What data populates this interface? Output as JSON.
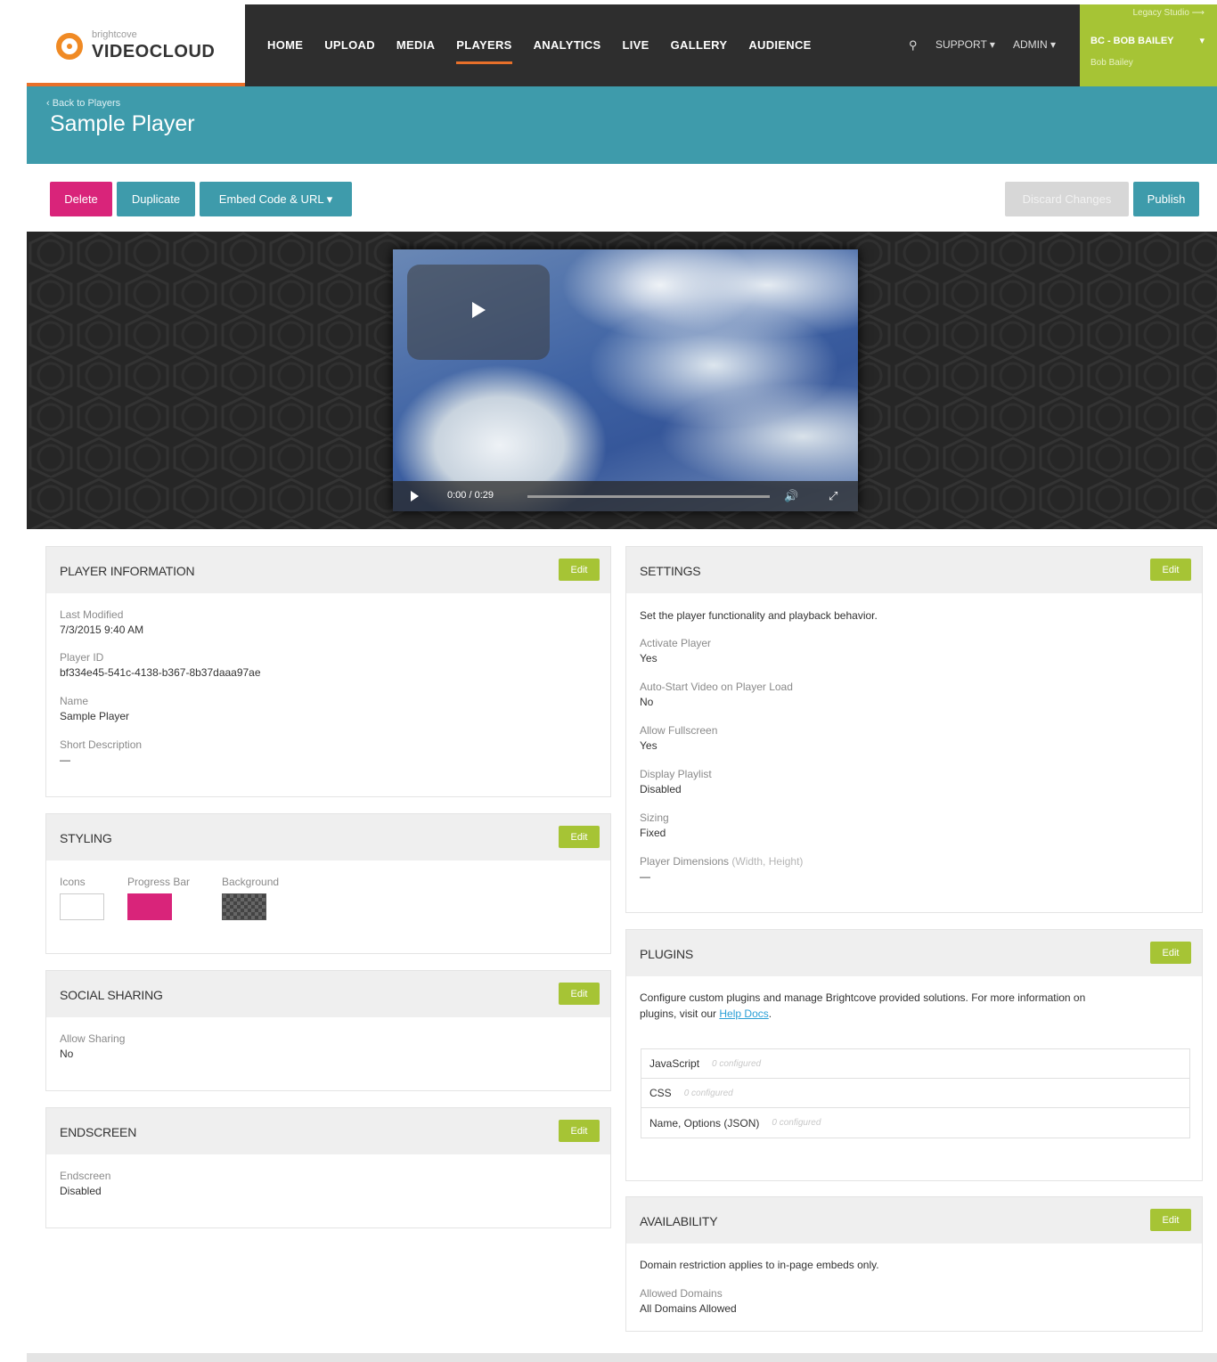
{
  "logo": {
    "small": "brightcove",
    "big": "VIDEOCLOUD"
  },
  "nav": [
    {
      "label": "HOME"
    },
    {
      "label": "UPLOAD"
    },
    {
      "label": "MEDIA"
    },
    {
      "label": "PLAYERS",
      "active": true
    },
    {
      "label": "ANALYTICS"
    },
    {
      "label": "LIVE"
    },
    {
      "label": "GALLERY"
    },
    {
      "label": "AUDIENCE"
    }
  ],
  "header": {
    "support": "SUPPORT ▾",
    "admin": "ADMIN ▾",
    "legacy": "Legacy Studio ⟶",
    "account": "BC - BOB BAILEY",
    "account_caret": "▾",
    "user": "Bob Bailey"
  },
  "page": {
    "back": "‹ Back to Players",
    "title": "Sample Player"
  },
  "actions": {
    "delete": "Delete",
    "duplicate": "Duplicate",
    "embed": "Embed Code & URL ▾",
    "discard": "Discard Changes",
    "publish": "Publish"
  },
  "video": {
    "time": "0:00  /  0:29"
  },
  "player_info": {
    "title": "PLAYER INFORMATION",
    "edit": "Edit",
    "fields": [
      {
        "label": "Last Modified",
        "value": "7/3/2015 9:40 AM"
      },
      {
        "label": "Player ID",
        "value": "bf334e45-541c-4138-b367-8b37daaa97ae"
      },
      {
        "label": "Name",
        "value": "Sample Player"
      },
      {
        "label": "Short Description",
        "value": "—"
      }
    ]
  },
  "styling": {
    "title": "STYLING",
    "edit": "Edit",
    "icons_label": "Icons",
    "progress_label": "Progress Bar",
    "background_label": "Background",
    "icons_color": "#ffffff",
    "progress_color": "#d9247a"
  },
  "social": {
    "title": "SOCIAL SHARING",
    "edit": "Edit",
    "label": "Allow Sharing",
    "value": "No"
  },
  "endscreen": {
    "title": "ENDSCREEN",
    "edit": "Edit",
    "label": "Endscreen",
    "value": "Disabled"
  },
  "settings": {
    "title": "SETTINGS",
    "edit": "Edit",
    "desc": "Set the player functionality and playback behavior.",
    "fields": [
      {
        "label": "Activate Player",
        "value": "Yes"
      },
      {
        "label": "Auto-Start Video on Player Load",
        "value": "No"
      },
      {
        "label": "Allow Fullscreen",
        "value": "Yes"
      },
      {
        "label": "Display Playlist",
        "value": "Disabled"
      },
      {
        "label": "Sizing",
        "value": "Fixed"
      },
      {
        "label": "Player Dimensions",
        "value": "—"
      }
    ],
    "dim_hint": "(Width, Height)"
  },
  "plugins": {
    "title": "PLUGINS",
    "edit": "Edit",
    "desc_line1": "Configure custom plugins and manage Brightcove provided solutions. For more information on",
    "desc_line2": "plugins, visit our",
    "link": "Help Docs",
    "rows": [
      {
        "label": "JavaScript",
        "status": "0 configured"
      },
      {
        "label": "CSS",
        "status": "0 configured"
      },
      {
        "label": "Name, Options (JSON)",
        "status": "0 configured"
      }
    ]
  },
  "availability": {
    "title": "AVAILABILITY",
    "edit": "Edit",
    "desc": "Domain restriction applies to in-page embeds only.",
    "label": "Allowed Domains",
    "value": "All Domains Allowed"
  },
  "colors": {
    "accent": "#3e9bab",
    "brand_orange": "#e8702a",
    "edit_green": "#a6c435",
    "delete_pink": "#d9247a"
  }
}
